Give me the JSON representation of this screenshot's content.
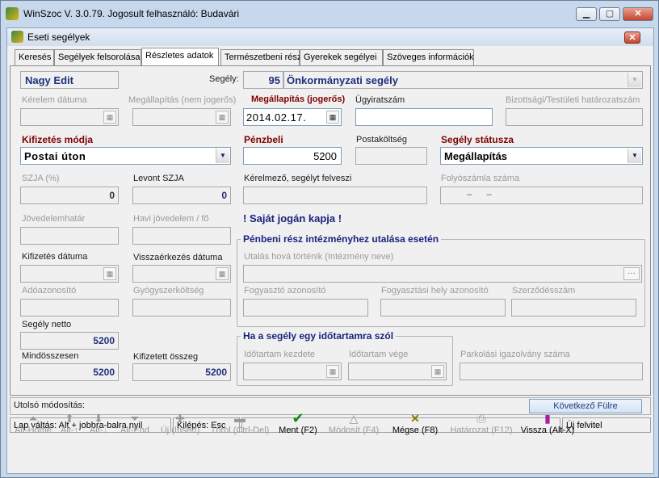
{
  "outer_window": {
    "title": "WinSzoc V. 3.0.79. Jogosult felhasználó: Budavári"
  },
  "inner_window": {
    "title": "Eseti segélyek"
  },
  "tabs": [
    "Keresés",
    "Segélyek felsorolása",
    "Részletes adatok",
    "Természetbeni rész",
    "Gyerekek segélyei",
    "Szöveges információk"
  ],
  "active_tab": "Részletes adatok",
  "form": {
    "name_value": "Nagy Edit",
    "segely_label": "Segély:",
    "segely_code": "95",
    "segely_type": "Önkormányzati segély",
    "kerelem_datuma_label": "Kérelem dátuma",
    "megallapitas_nem_label": "Megállapítás (nem jogerős)",
    "megallapitas_jogeros_label": "Megállapítás (jogerős)",
    "megallapitas_jogeros_value": "2014.02.17.",
    "ugyiratszam_label": "Ügyiratszám",
    "bizottsagi_label": "Bizottsági/Testületi határozatszám",
    "kifizetes_modja_label": "Kifizetés módja",
    "kifizetes_modja_value": "Postai úton",
    "penzbeli_label": "Pénzbeli",
    "penzbeli_value": "5200",
    "postakoltseg_label": "Postaköltség",
    "segely_statusza_label": "Segély státusza",
    "segely_statusza_value": "Megállapítás",
    "szja_label": "SZJA (%)",
    "szja_value": "0",
    "levont_szja_label": "Levont SZJA",
    "levont_szja_value": "0",
    "kerelmezo_label": "Kérelmező, segélyt felveszi",
    "folyoszamla_label": "Folyószámla száma",
    "folyoszamla_value": "–      –",
    "jovedelemhatar_label": "Jövedelemhatár",
    "havi_jovedelem_label": "Havi jövedelem / fő",
    "sajat_jogan": "! Saját jogán kapja !",
    "kifizetes_datuma_label": "Kifizetés dátuma",
    "visszaerkezes_label": "Visszaérkezés dátuma",
    "adoazonosito_label": "Adóazonosító",
    "gyogyszerkoltseg_label": "Gyógyszerköltség",
    "segely_netto_label": "Segély netto",
    "segely_netto_value": "5200",
    "mindosszesen_label": "Mindösszesen",
    "mindosszesen_value": "5200",
    "kifizetett_osszeg_label": "Kifizetett összeg",
    "kifizetett_osszeg_value": "5200",
    "intezmeny_group_title": "Pénbeni rész intézményhez utalása esetén",
    "utalas_label": "Utalás hová történik (Intézmény neve)",
    "ellipsis": "···",
    "fogyaszto_label": "Fogyasztó azonosító",
    "fogyasztasi_hely_label": "Fogyasztási hely azonosító",
    "szerzodesszam_label": "Szerződésszám",
    "idotartam_group_title": "Ha a segély egy időtartamra szól",
    "idotartam_kezdete_label": "Időtartam kezdete",
    "idotartam_vege_label": "Időtartam vége",
    "parkolasi_label": "Parkolási igazolvány száma"
  },
  "status": {
    "utolso_modositas": "Utolsó módosítás:",
    "kovetkezo_ful": "Következő Fülre",
    "lap_valtas": "Lap váltás: Alt + jobbra-balra nyil",
    "kilepes": "Kilépés: Esc",
    "uj_felvitel": "Új felvitel"
  },
  "toolbar": [
    {
      "label": "Alt-Home",
      "icon": "first-record-icon",
      "enabled": false
    },
    {
      "label": "Alt-↑",
      "icon": "up-arrow-icon",
      "enabled": false
    },
    {
      "label": "Alt-↓",
      "icon": "down-arrow-icon",
      "enabled": false
    },
    {
      "label": "Alt-End",
      "icon": "last-record-icon",
      "enabled": false
    },
    {
      "label": "Új (Insert)",
      "icon": "plus-icon",
      "enabled": false
    },
    {
      "label": "Törol (Ctrl-Del)",
      "icon": "minus-icon",
      "enabled": false
    },
    {
      "label": "Ment (F2)",
      "icon": "checkmark-icon",
      "enabled": true
    },
    {
      "label": "Módosít (F4)",
      "icon": "triangle-icon",
      "enabled": false
    },
    {
      "label": "Mégse (F8)",
      "icon": "cross-icon",
      "enabled": true
    },
    {
      "label": "Határozat (F12)",
      "icon": "printer-icon",
      "enabled": false
    },
    {
      "label": "Vissza (Alt-X)",
      "icon": "exit-door-icon",
      "enabled": true
    }
  ],
  "colors": {
    "required_label": "#800000",
    "value_navy": "#1e2f7c",
    "group_title": "#1a237e"
  }
}
